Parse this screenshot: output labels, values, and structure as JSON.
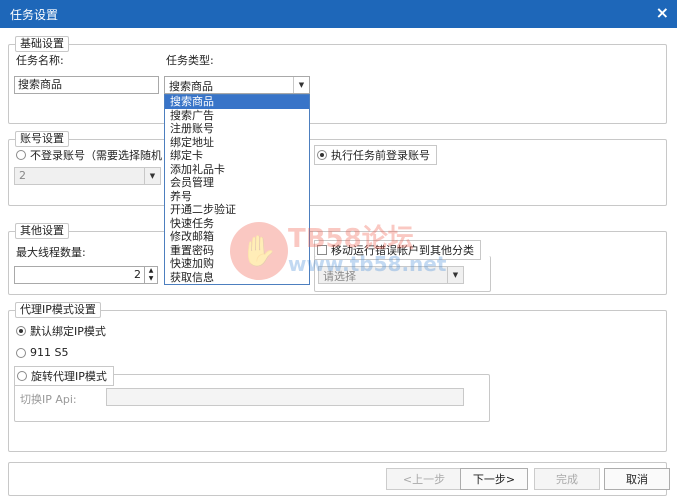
{
  "window": {
    "title": "任务设置",
    "close_label": "×"
  },
  "basic": {
    "legend": "基础设置",
    "task_name_label": "任务名称:",
    "task_name_value": "搜索商品",
    "task_type_label": "任务类型:",
    "task_type_value": "搜索商品",
    "task_type_options": [
      "搜索商品",
      "搜索广告",
      "注册账号",
      "绑定地址",
      "绑定卡",
      "添加礼品卡",
      "会员管理",
      "养号",
      "开通二步验证",
      "快速任务",
      "修改邮箱",
      "重置密码",
      "快速加购",
      "获取信息"
    ],
    "selected_index": 0
  },
  "account": {
    "legend": "账号设置",
    "no_login_label": "不登录账号（需要选择随机",
    "login_before_label": "执行任务前登录账号",
    "count_value": "2"
  },
  "other": {
    "legend": "其他设置",
    "max_threads_label": "最大线程数量:",
    "max_threads_value": "2",
    "move_error_label": "移动运行错误帐户到其他分类",
    "category_placeholder": "请选择"
  },
  "proxy": {
    "legend": "代理IP模式设置",
    "default_ip_label": "默认绑定IP模式",
    "s5_label": "911 S5",
    "rotate_label": "旋转代理IP模式",
    "switch_api_label": "切换IP Api:",
    "switch_api_value": ""
  },
  "buttons": {
    "prev": "<上一步",
    "next": "下一步>",
    "finish": "完成",
    "cancel": "取消"
  },
  "watermark": {
    "brand": "TB58论坛",
    "url": "www.tb58.net"
  }
}
